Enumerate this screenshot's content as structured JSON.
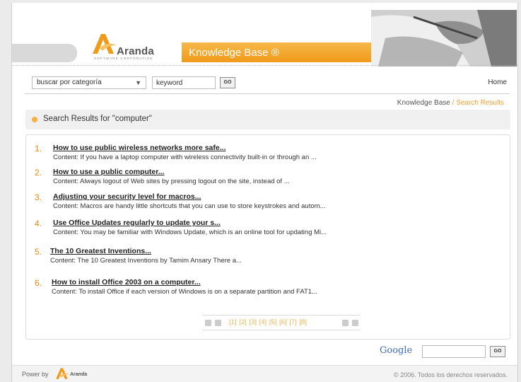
{
  "header": {
    "brand": "Aranda",
    "brand_sub": "SOFTWARE CORPORATION",
    "product_title": "Knowledge Base ®"
  },
  "search": {
    "category_selected": "buscar por categoría",
    "keyword_value": "keyword",
    "go_label": "GO",
    "home_label": "Home"
  },
  "breadcrumb": {
    "root": "Knowledge Base",
    "separator": " / ",
    "current": "Search Results"
  },
  "results_heading": "Search Results for \"computer\"",
  "results": [
    {
      "num": "1.",
      "title": "How to use public wireless networks more safe...",
      "content": "Content:  If you have a laptop computer with wireless connectivity built-in or through an ..."
    },
    {
      "num": "2.",
      "title": "How to use a public computer...",
      "content": "Content:  Always logout of Web sites by pressing logout on the site, instead of ..."
    },
    {
      "num": "3.",
      "title": "Adjusting your security level for macros...",
      "content": "Content:  Macros are handy little shortcuts that you can use to store keystrokes and autom..."
    },
    {
      "num": "4.",
      "title": "Use Office Updates regularly to update your s...",
      "content": "Content:  You may be familiar with Windows Update, which is an online tool for updating Mi..."
    },
    {
      "num": "5.",
      "title": "The 10 Greatest Inventions...",
      "content": "Content:    The 10 Greatest Inventions by Tamim Ansary There a..."
    },
    {
      "num": "6.",
      "title": "How to install Office 2003 on a computer...",
      "content": "Content:  To install Office if each version of Windows is on a separate partition and FAT1..."
    }
  ],
  "pagination": {
    "pages": "[1] [2] [3] [4] [5] [6] [7] [8]"
  },
  "google": {
    "logo": "Google",
    "go_label": "GO"
  },
  "footer": {
    "power_by": "Power by",
    "brand": "Aranda",
    "copyright": "© 2006. Todos los derechos reservados."
  },
  "colors": {
    "accent_orange": "#f09a1a",
    "number_orange": "#f08a10",
    "pager_orange": "#f3b24e"
  }
}
